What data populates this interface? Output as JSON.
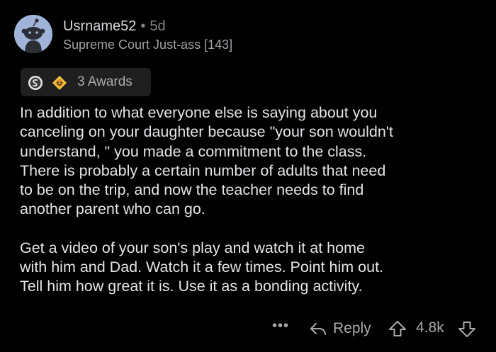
{
  "comment": {
    "username": "Usrname52",
    "separator": "•",
    "age": "5d",
    "flair": "Supreme Court Just-ass [143]",
    "awards_label": "3 Awards",
    "award_icons": [
      "silver-award-icon",
      "gold-award-icon"
    ],
    "paragraphs": [
      "In addition to what everyone else is saying about you\ncanceling on your daughter because \"your son wouldn't\nunderstand, \" you made a commitment to the class.\nThere is probably a certain number of adults that need\nto be on the trip, and now the teacher needs to find\nanother parent who can go.",
      "Get a video of your son's play and watch it at home\nwith him and Dad. Watch it a few times. Point him out.\nTell him how great it is. Use it as a bonding activity."
    ]
  },
  "actions": {
    "more_label": "•••",
    "reply_label": "Reply",
    "score": "4.8k"
  },
  "colors": {
    "background": "#000000",
    "text": "#e2e4e6",
    "muted": "#818384",
    "awards_bg": "#1f1f1f",
    "avatar_bg": "#9fb4d8"
  }
}
